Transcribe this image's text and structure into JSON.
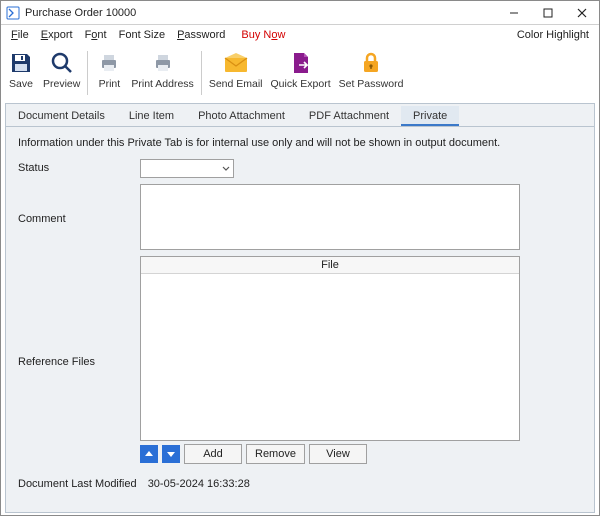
{
  "window": {
    "title": "Purchase Order 10000"
  },
  "menubar": {
    "file": "File",
    "export": "Export",
    "font": "Font",
    "font_size": "Font Size",
    "password": "Password",
    "buy_now": "Buy Now",
    "color_highlight": "Color Highlight"
  },
  "toolbar": {
    "save": "Save",
    "preview": "Preview",
    "print": "Print",
    "print_address": "Print Address",
    "send_email": "Send Email",
    "quick_export": "Quick Export",
    "set_password": "Set Password"
  },
  "tabs": {
    "document_details": "Document Details",
    "line_item": "Line Item",
    "photo_attachment": "Photo Attachment",
    "pdf_attachment": "PDF Attachment",
    "private": "Private"
  },
  "private": {
    "info": "Information under this Private Tab is for internal use only and will not be shown in output document.",
    "status_label": "Status",
    "status_value": "",
    "comment_label": "Comment",
    "comment_value": "",
    "reference_files_label": "Reference Files",
    "file_header": "File",
    "add": "Add",
    "remove": "Remove",
    "view": "View",
    "last_modified_label": "Document Last Modified",
    "last_modified_value": "30-05-2024 16:33:28"
  }
}
